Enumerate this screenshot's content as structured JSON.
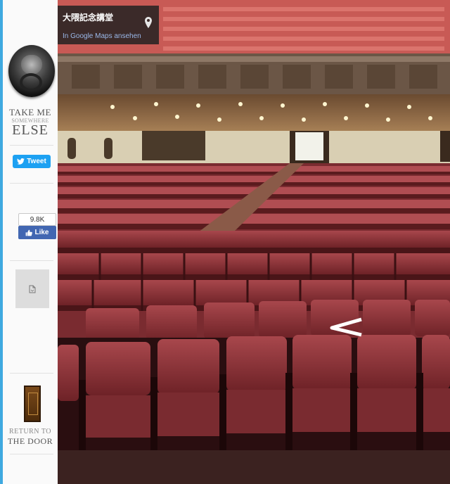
{
  "sidebar": {
    "tagline_line1": "TAKE ME",
    "tagline_line2": "SOMEWHERE",
    "tagline_line3": "ELSE",
    "tweet_label": "Tweet",
    "like_count": "9.8K",
    "like_label": "Like",
    "return_line1": "RETURN TO",
    "return_line2": "THE DOOR"
  },
  "maps_overlay": {
    "place_name": "大隈記念講堂",
    "view_link": "In Google Maps ansehen"
  },
  "colors": {
    "sidebar_accent": "#3fa9e0",
    "twitter_blue": "#1da1f2",
    "facebook_blue": "#4267b2",
    "seat_red": "#8a2f35"
  }
}
